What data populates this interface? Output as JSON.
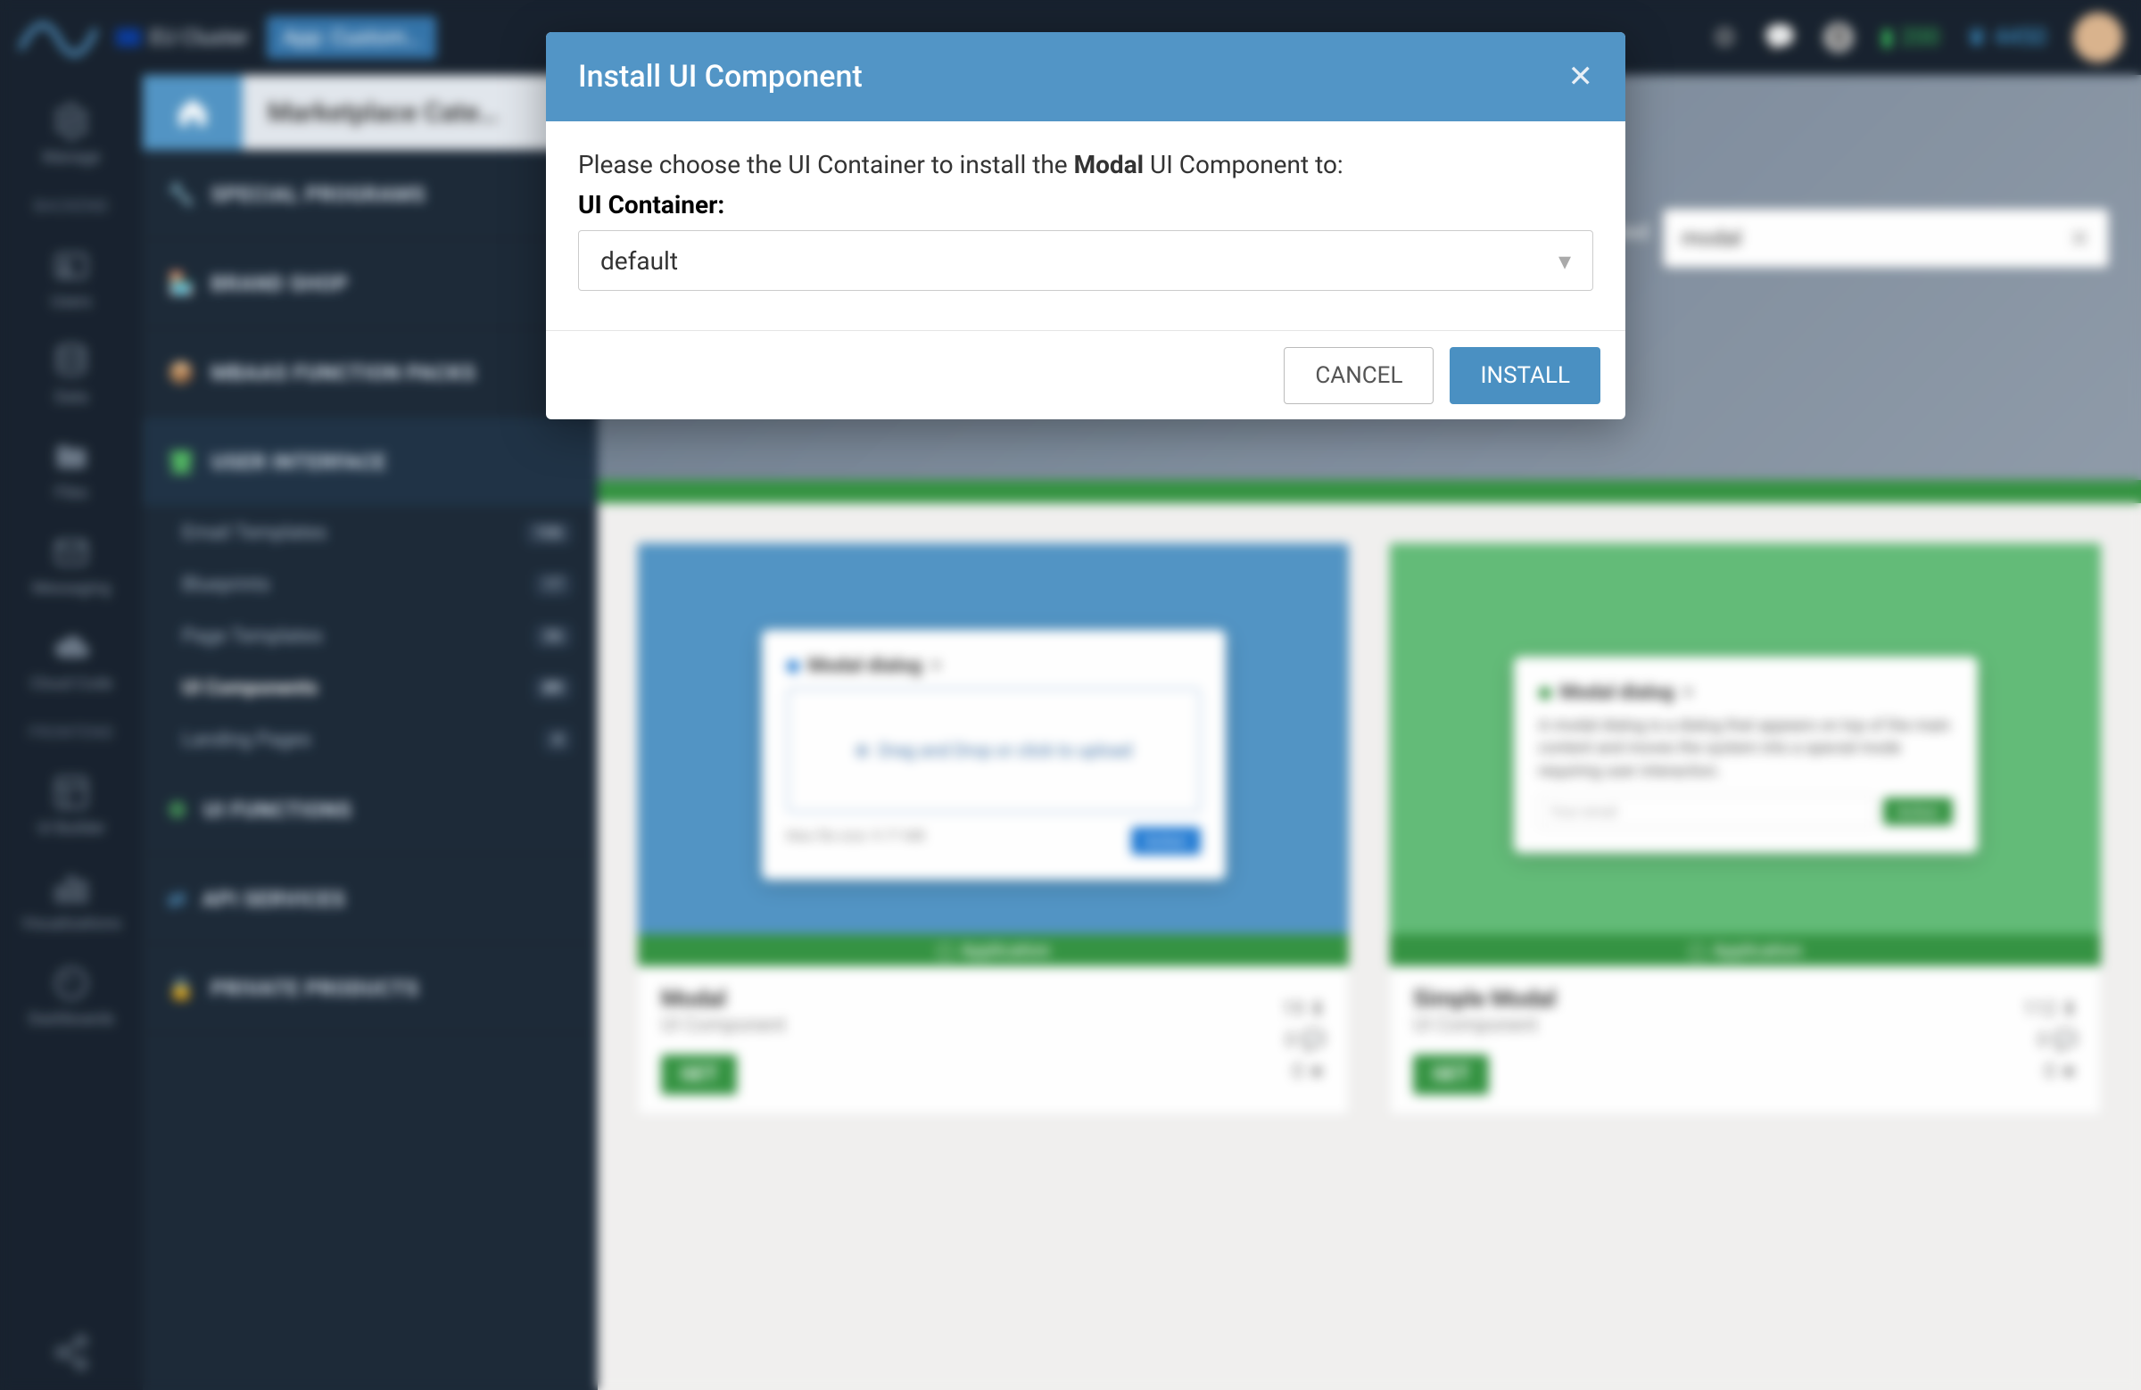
{
  "topbar": {
    "cluster_label": "EU Cluster",
    "app_pill": "App: Custom…",
    "credits_green": "200",
    "credits_blue": "4450"
  },
  "rail": {
    "items": [
      {
        "label": "Manage"
      },
      {
        "label": "Users"
      },
      {
        "label": "Data"
      },
      {
        "label": "Files"
      },
      {
        "label": "Messaging"
      },
      {
        "label": "Cloud Code"
      },
      {
        "label": "UI Builder"
      },
      {
        "label": "Visualizations"
      },
      {
        "label": "Dashboards"
      }
    ],
    "sections": [
      "BACKEND",
      "FRONTEND"
    ]
  },
  "sidebar": {
    "breadcrumb": "Marketplace Cate…",
    "categories": [
      {
        "label": "SPECIAL PROGRAMS"
      },
      {
        "label": "BRAND SHOP"
      },
      {
        "label": "MBAAS FUNCTION PACKS"
      },
      {
        "label": "USER INTERFACE"
      },
      {
        "label": "UI FUNCTIONS"
      },
      {
        "label": "API SERVICES"
      },
      {
        "label": "PRIVATE PRODUCTS"
      }
    ],
    "subs": [
      {
        "label": "Email Templates",
        "count": "106"
      },
      {
        "label": "Blueprints",
        "count": "17"
      },
      {
        "label": "Page Templates",
        "count": "36"
      },
      {
        "label": "UI Components",
        "count": "89"
      },
      {
        "label": "Landing Pages",
        "count": "4"
      }
    ]
  },
  "main": {
    "rejected_label": "Rejected",
    "search_value": "modal",
    "app_strip": "Application",
    "cards": [
      {
        "title": "Modal",
        "type": "UI Component",
        "get": "GET",
        "downloads": "19",
        "comments": "0",
        "stars": "0",
        "preview": {
          "heading": "Modal dialog",
          "drop": "Drag and Drop or click to upload",
          "note": "Max file size: 9.77 MB",
          "action": "Action"
        }
      },
      {
        "title": "Simple Modal",
        "type": "UI Component",
        "get": "GET",
        "downloads": "112",
        "comments": "0",
        "stars": "0",
        "preview": {
          "heading": "Modal dialog",
          "body": "A modal dialog is a dialog that appears on top of the main content and moves the system into a special mode requiring user interaction.",
          "placeholder": "Your email",
          "action": "Action"
        }
      }
    ]
  },
  "modal": {
    "title": "Install UI Component",
    "prompt_pre": "Please choose the UI Container to install the ",
    "prompt_bold": "Modal",
    "prompt_post": " UI Component to:",
    "label": "UI Container:",
    "selected": "default",
    "cancel": "CANCEL",
    "install": "INSTALL"
  }
}
